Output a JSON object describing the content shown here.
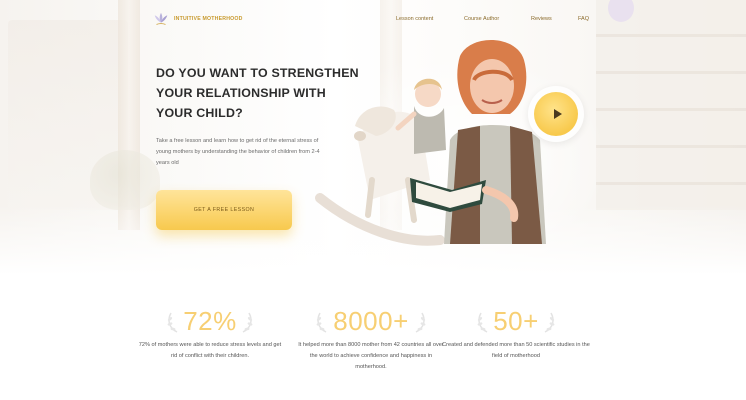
{
  "brand": {
    "logo_icon": "lotus-icon",
    "name": "INTUITIVE MOTHERHOOD"
  },
  "nav": [
    {
      "label": "Lesson content"
    },
    {
      "label": "Course Author"
    },
    {
      "label": "Reviews"
    },
    {
      "label": "FAQ"
    }
  ],
  "hero": {
    "headline_lines": [
      "DO YOU WANT TO STRENGTHEN",
      "YOUR RELATIONSHIP WITH",
      "YOUR CHILD?"
    ],
    "subtext": "Take a free lesson and learn how to get rid of the eternal stress of young mothers by understanding the behavior of children from 2-4 years old",
    "cta_label": "GET A FREE LESSON",
    "play_icon": "play-icon"
  },
  "stats": [
    {
      "number": "72%",
      "text": "72% of mothers were able to reduce stress levels and get rid of conflict with their children."
    },
    {
      "number": "8000+",
      "text": "It helped more than 8000 mother from 42 countries all over the world to achieve confidence and happiness in motherhood."
    },
    {
      "number": "50+",
      "text": "Created and defended more than 50 scientific studies in the field of motherhood"
    }
  ],
  "colors": {
    "accent": "#f7cf73",
    "cta": "#fbd46c",
    "brand_text": "#c89a2e"
  }
}
